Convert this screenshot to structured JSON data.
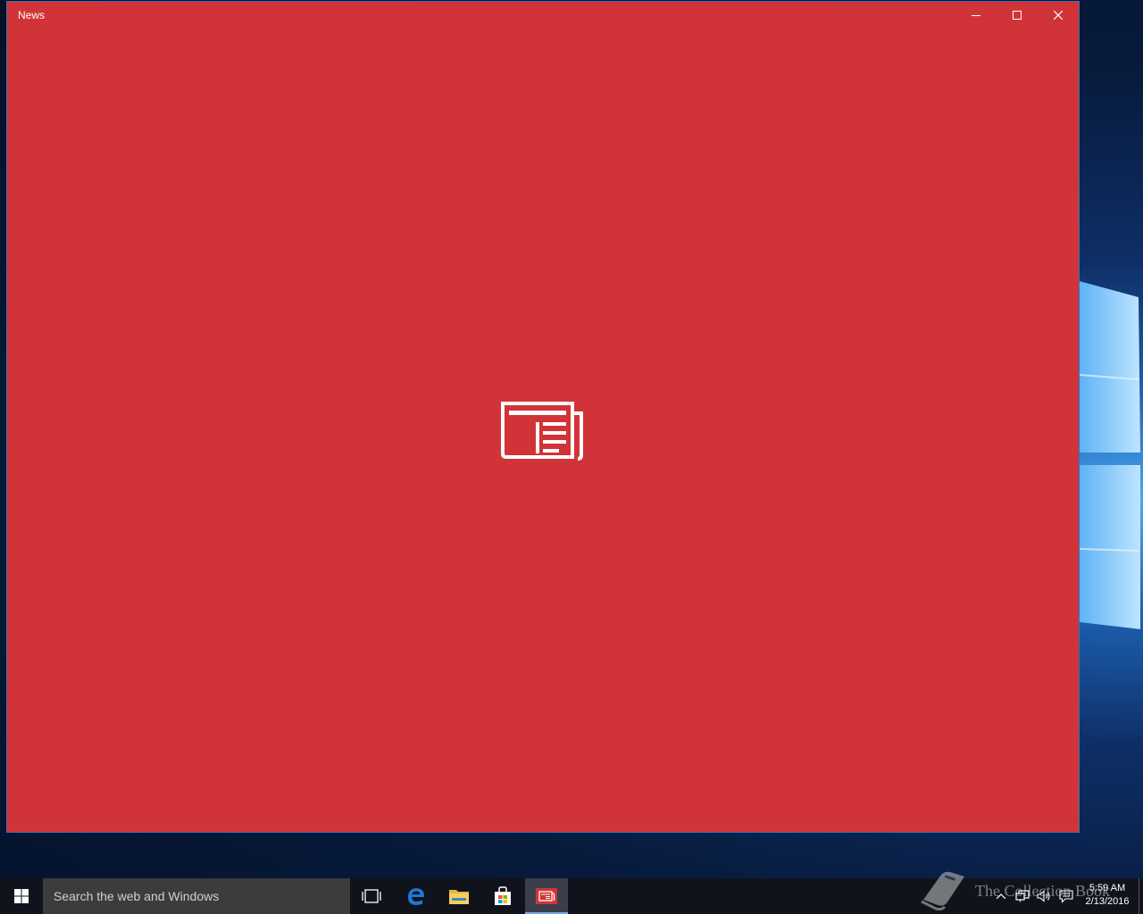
{
  "window": {
    "title": "News",
    "background": "#d13438",
    "controls": {
      "minimize_icon": "minimize-icon",
      "maximize_icon": "maximize-icon",
      "close_icon": "close-icon"
    },
    "splash_icon": "newspaper-icon"
  },
  "taskbar": {
    "search_placeholder": "Search the web and Windows",
    "pinned": [
      "task-view-icon",
      "edge-icon",
      "file-explorer-icon",
      "store-icon",
      "news-icon"
    ],
    "active_app": "news-icon",
    "watermark": "The Collection Book",
    "clock": {
      "time": "5:59 AM",
      "date": "2/13/2016"
    }
  },
  "colors": {
    "accent": "#d13438",
    "taskbar": "#10131c",
    "search": "#3c3c3c",
    "active_indicator": "#79a8e6"
  }
}
